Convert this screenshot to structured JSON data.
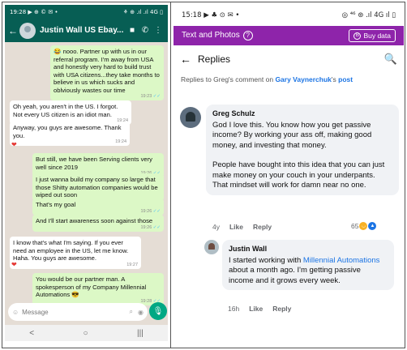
{
  "whatsapp": {
    "status": {
      "time": "19:28",
      "icons": "▶ ⊕ © ✉ •",
      "right": "⚘ ⊕ .ıl .ıl 4G ▯"
    },
    "header": {
      "back": "←",
      "name": "Justin Wall US Ebay...",
      "video_icon": "■",
      "call_icon": "✆",
      "menu_icon": "⋮"
    },
    "messages": [
      {
        "dir": "out",
        "text": "😂 nooo. Partner up with us in our referral program. I'm away from USA and honestly very hard to build trust with USA citizens...they take months to believe in us which sucks and oblviously wastes our time",
        "time": "19:23",
        "tick": "✓✓"
      },
      {
        "dir": "in",
        "text": "Oh yeah, you aren't in the US. I forgot. Not every US citizen is an idiot man.",
        "time": "19:24"
      },
      {
        "dir": "in",
        "text": "Anyway, you guys are awesome. Thank you.",
        "time": "19:24"
      },
      {
        "dir": "out",
        "text": "But still, we have been Serving clients very well since 2019",
        "time": "19:26",
        "tick": "✓✓"
      },
      {
        "dir": "out",
        "text": "I just wanna build my company so large that those Shitty automation companies would be wiped out soon",
        "time": ""
      },
      {
        "dir": "out",
        "text": "That's my goal",
        "time": "19:26",
        "tick": "✓✓"
      },
      {
        "dir": "out",
        "text": "And I'll start awareness soon against those",
        "time": "19:26",
        "tick": "✓✓"
      },
      {
        "dir": "in",
        "text": "I know that's what I'm saying. If you ever need an employee in the US, let me know. Haha. You guys are awesome.",
        "time": "19:27"
      },
      {
        "dir": "out",
        "text": "You would be our partner man. A spokesperson of my Company Millennial Automations 😎",
        "time": "19:28",
        "tick": "✓✓"
      }
    ],
    "hearts": [
      "❤",
      "❤"
    ],
    "input": {
      "emoji_icon": "☺",
      "placeholder": "Message",
      "attach_icon": "⌕",
      "camera_icon": "◉",
      "mic_icon": "🎙"
    },
    "nav": {
      "back": "<",
      "home": "○",
      "recent": "|||"
    }
  },
  "facebook": {
    "status": {
      "time": "15:18",
      "icons": "▶ ♣ ⊙ ✉ •",
      "right": "◎ ⁴⁶ ⊛ .ıl 4G ıl ▯"
    },
    "banner": {
      "label": "Text and Photos",
      "help": "?",
      "buy_icon": "B",
      "buy_label": "Buy data"
    },
    "replies_bar": {
      "back": "←",
      "title": "Replies",
      "search": "🔍"
    },
    "context": {
      "prefix": "Replies to Greg's comment on ",
      "author": "Gary Vaynerchuk",
      "possessive": "'s ",
      "post": "post"
    },
    "comment": {
      "author": "Greg Schulz",
      "para1": "God I love this. You know how you get passive income? By working your ass off, making good money, and investing that money.",
      "para2": "People have bought into this idea that you can just make money on your couch in your underpants. That mindset will work for damn near no one.",
      "time": "4y",
      "like": "Like",
      "reply": "Reply",
      "reactions": "65"
    },
    "reply": {
      "author": "Justin Wall",
      "pre": "I started working with ",
      "link": "Millennial Automations",
      "post": " about a month ago. I'm getting passive income and it grows every week.",
      "time": "16h",
      "like": "Like",
      "reply": "Reply"
    }
  }
}
